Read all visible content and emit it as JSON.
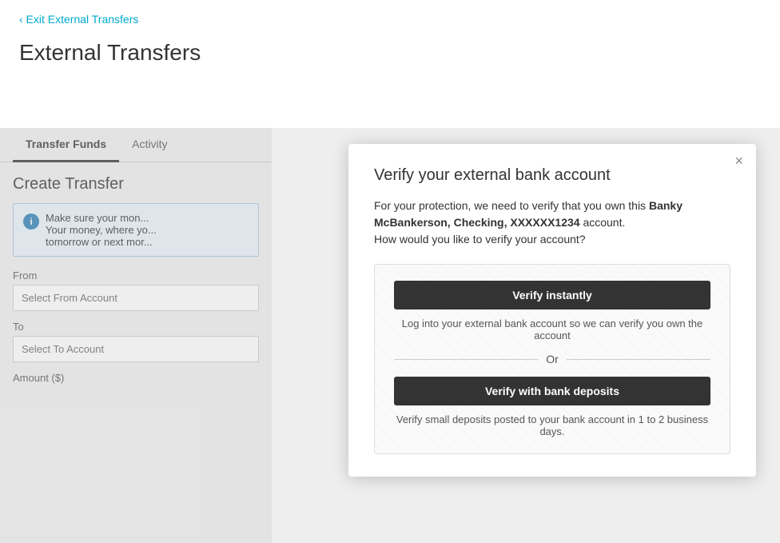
{
  "header": {
    "exit_link_text": "‹ Exit External Transfers",
    "page_title": "External Transfers"
  },
  "tabs": [
    {
      "label": "Transfer Funds",
      "active": true
    },
    {
      "label": "Activity",
      "active": false
    }
  ],
  "form": {
    "title": "Create Transfer",
    "info_icon": "i",
    "info_text_line1": "Make sure your mon...",
    "info_text_line2": "Your money, where yo...",
    "info_text_line3": "tomorrow or next mor...",
    "from_label": "From",
    "from_placeholder": "Select From Account",
    "to_label": "To",
    "to_placeholder": "Select To Account",
    "amount_label": "Amount ($)"
  },
  "modal": {
    "title": "Verify your external bank account",
    "close_label": "×",
    "desc_prefix": "For your protection, we need to verify that you own this ",
    "account_name": "Banky McBankerson, Checking, XXXXXX1234",
    "desc_suffix": " account.",
    "question": "How would you like to verify your account?",
    "verify_instantly_btn": "Verify instantly",
    "verify_instantly_desc": "Log into your external bank account so we can verify you own the account",
    "or_text": "Or",
    "verify_deposits_btn": "Verify with bank deposits",
    "verify_deposits_desc": "Verify small deposits posted to your bank account in 1 to 2 business days."
  }
}
